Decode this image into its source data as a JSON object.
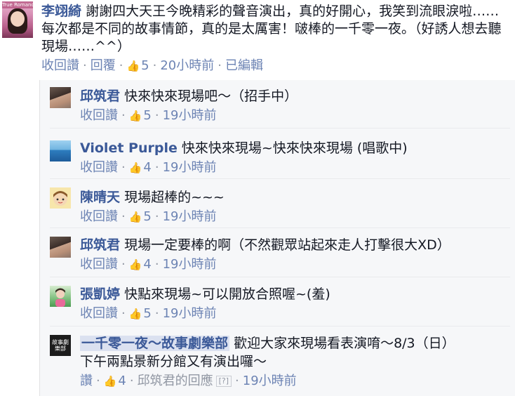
{
  "main_comment": {
    "avatar_tag": "True Romance",
    "author": "李翊綺",
    "text": "謝謝四大天王今晚精彩的聲音演出，真的好開心，我笑到流眼淚啦……每次都是不同的故事情節，真的是太厲害！啵棒的一千零一夜。（好誘人想去聽現場……^^）",
    "actions": {
      "unlike": "收回讚",
      "reply": "回覆"
    },
    "likes": "5",
    "time": "20小時前",
    "edited": "已編輯"
  },
  "replies": [
    {
      "author": "邱筑君",
      "text": "快來快來現場吧～（招手中）",
      "action": "收回讚",
      "likes": "5",
      "time": "19小時前"
    },
    {
      "author": "Violet Purple",
      "text": "快來快來現場~快來快來現場 (唱歌中)",
      "action": "收回讚",
      "likes": "4",
      "time": "19小時前"
    },
    {
      "author": "陳晴天",
      "text": "現場超棒的~~~",
      "action": "收回讚",
      "likes": "5",
      "time": "19小時前"
    },
    {
      "author": "邱筑君",
      "text": "現場一定要棒的啊（不然觀眾站起來走人打擊很大XD）",
      "action": "收回讚",
      "likes": "4",
      "time": "19小時前"
    },
    {
      "author": "張凱婷",
      "text": "快點來現場~可以開放合照喔~(羞)",
      "action": "收回讚",
      "likes": "5",
      "time": "19小時前"
    },
    {
      "avatar_text": "故事劇樂部",
      "author": "一千零一夜～故事劇樂部",
      "text": "歡迎大家來現場看表演唷～8/3（日）",
      "text2": "下午兩點景新分館又有演出囉～",
      "action": "讚",
      "likes": "4",
      "reply_note": "邱筑君的回應",
      "help": "[?]",
      "time": "19小時前"
    }
  ],
  "ui": {
    "like_icon": "thumbs-up-icon",
    "separator": "·",
    "link_color": "#6d84b4",
    "author_color": "#3b5998",
    "reply_bg": "#f6f7f9"
  }
}
